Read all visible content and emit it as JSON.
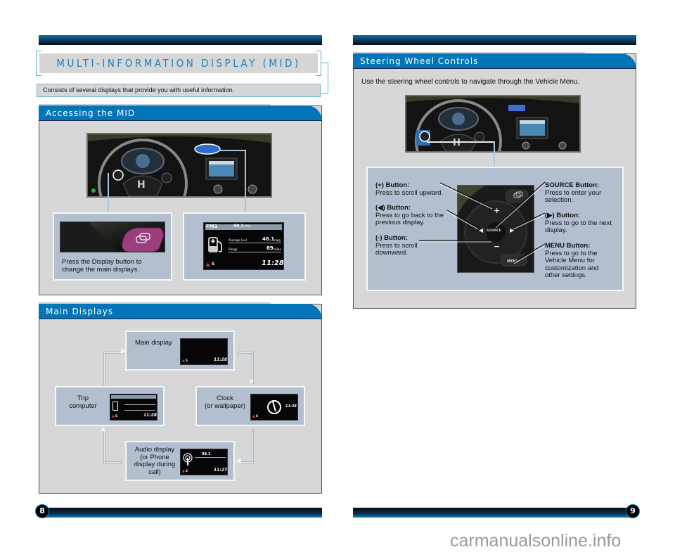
{
  "left_page": {
    "page_number": "8",
    "title": "MULTI-INFORMATION DISPLAY (MID)",
    "intro": "Consists of several displays that provide you with useful information.",
    "accessing": {
      "heading": "Accessing the MID",
      "caption": "Press the Display button to change the main displays.",
      "lcd": {
        "source": "FM1",
        "frequency": "98.1",
        "freq_unit": "MHz",
        "avg_fuel_label": "Average Fuel",
        "avg_fuel_value": "46.1",
        "avg_fuel_unit": "mpg",
        "range_label": "Range",
        "range_value": "89",
        "range_unit": "miles",
        "gear": "S",
        "time": "11:28"
      }
    },
    "main_displays": {
      "heading": "Main Displays",
      "items": [
        {
          "label": "Main display",
          "time": "11:28",
          "gear": "S"
        },
        {
          "label": "Clock (or wallpaper)",
          "time": "11:28",
          "gear": "S"
        },
        {
          "label": "Audio display (or Phone display during call)",
          "time": "11:27",
          "gear": "S",
          "frequency": "98.1"
        },
        {
          "label": "Trip computer",
          "time": "11:28",
          "gear": "S"
        }
      ],
      "labels_split": {
        "trip": [
          "Trip",
          "computer"
        ],
        "clock": [
          "Clock",
          "(or wallpaper)"
        ],
        "audio": [
          "Audio display",
          "(or Phone",
          "display during",
          "call)"
        ]
      }
    }
  },
  "right_page": {
    "page_number": "9",
    "steering": {
      "heading": "Steering Wheel Controls",
      "intro": "Use the steering wheel controls to navigate through the Vehicle Menu.",
      "controls": [
        {
          "title": "(+) Button:",
          "lines": [
            "Press to scroll upward."
          ]
        },
        {
          "title": "(◀) Button:",
          "lines": [
            "Press to go back to the",
            "previous display."
          ]
        },
        {
          "title": "(-) Button:",
          "lines": [
            "Press to scroll",
            "downward."
          ]
        },
        {
          "title": "SOURCE Button:",
          "lines": [
            "Press to enter your",
            "selection."
          ]
        },
        {
          "title": "(▶) Button:",
          "lines": [
            "Press to go to the next",
            "display."
          ]
        },
        {
          "title": "MENU Button:",
          "lines": [
            "Press to go to the",
            "Vehicle Menu for",
            "customization and",
            "other settings."
          ]
        }
      ],
      "pad_labels": {
        "source": "SOURCE",
        "menu": "MENU",
        "plus": "+",
        "minus": "−",
        "left": "◀",
        "right": "▶"
      }
    }
  },
  "watermark": "carmanualsonline.info"
}
